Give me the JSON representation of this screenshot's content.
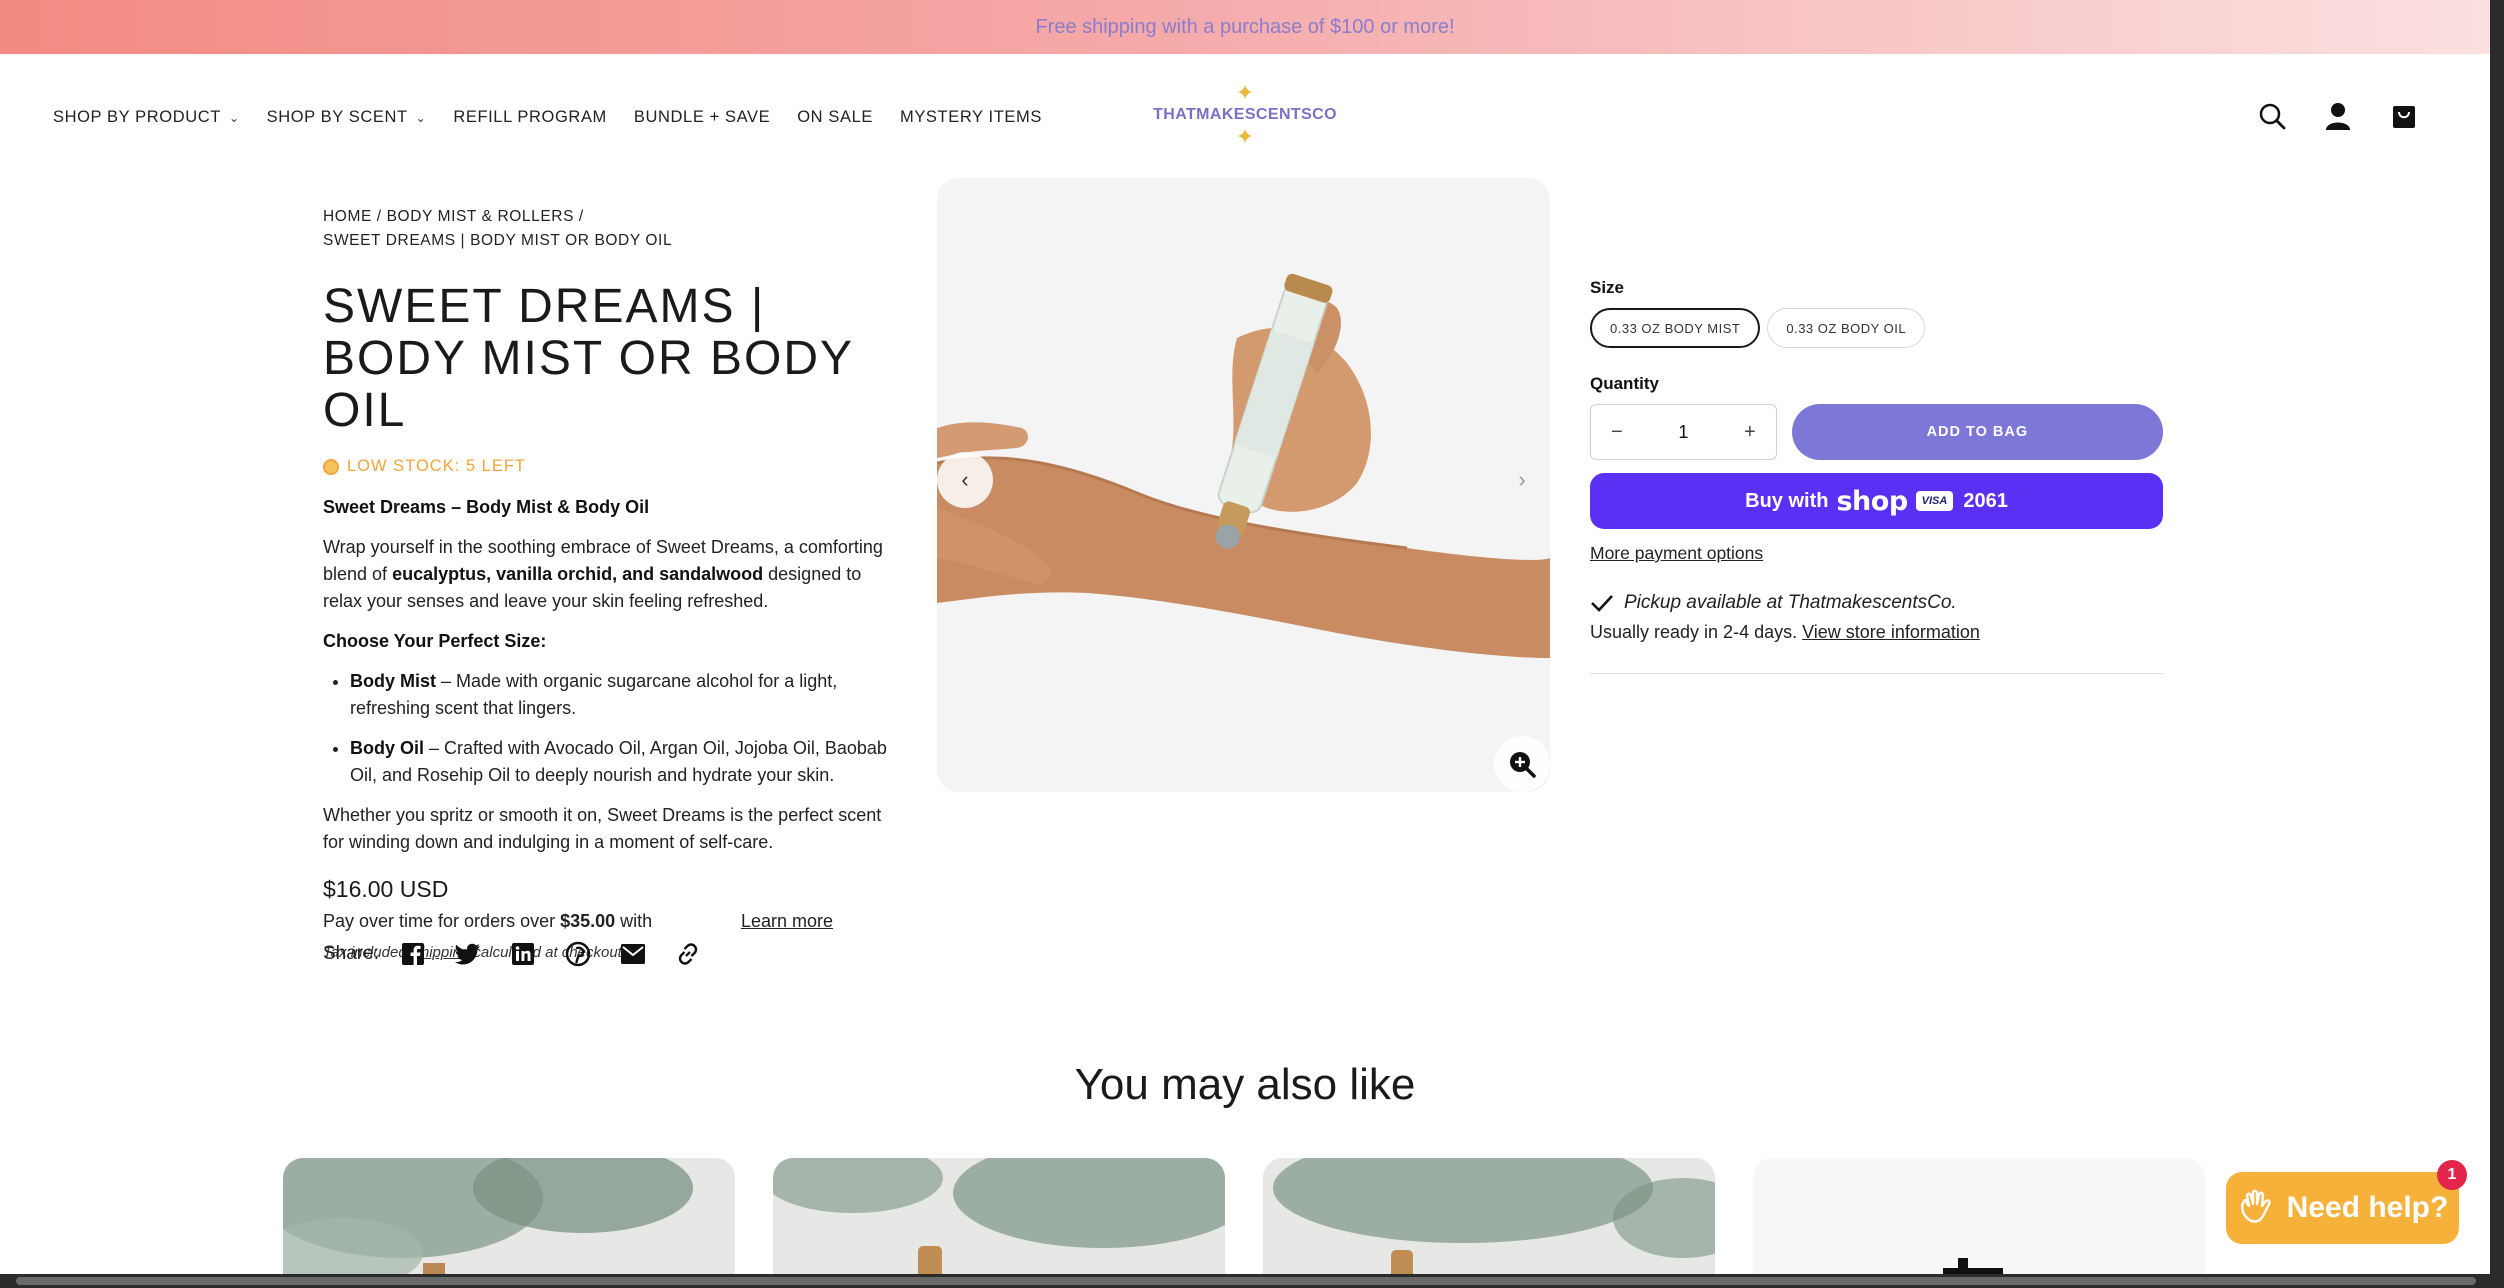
{
  "announcement": "Free shipping with a purchase of $100 or more!",
  "nav": [
    {
      "label": "SHOP BY PRODUCT",
      "dropdown": true
    },
    {
      "label": "SHOP BY SCENT",
      "dropdown": true
    },
    {
      "label": "REFILL PROGRAM",
      "dropdown": false
    },
    {
      "label": "BUNDLE + SAVE",
      "dropdown": false
    },
    {
      "label": "ON SALE",
      "dropdown": false
    },
    {
      "label": "MYSTERY ITEMS",
      "dropdown": false
    }
  ],
  "logo": {
    "text": "THATMAKESCENTSCO",
    "star_color": "#e6b93a",
    "text_color": "#7b70c6"
  },
  "header_icons": [
    "search-icon",
    "account-icon",
    "cart-icon"
  ],
  "breadcrumb": {
    "line1": "HOME / BODY MIST & ROLLERS /",
    "line2": "SWEET DREAMS | BODY MIST OR BODY OIL"
  },
  "product": {
    "title": "SWEET DREAMS | BODY MIST OR BODY OIL",
    "stock": "LOW STOCK: 5 LEFT",
    "desc_heading": "Sweet Dreams – Body Mist & Body Oil",
    "desc_p1_a": "Wrap yourself in the soothing embrace of Sweet Dreams, a comforting blend of ",
    "desc_p1_b": "eucalyptus, vanilla orchid, and sandalwood",
    "desc_p1_c": " designed to relax your senses and leave your skin feeling refreshed.",
    "choose_heading": "Choose Your Perfect Size:",
    "bullet1_b": "Body Mist",
    "bullet1_t": " – Made with organic sugarcane alcohol for a light, refreshing scent that lingers.",
    "bullet2_b": "Body Oil",
    "bullet2_t": " – Crafted with Avocado Oil, Argan Oil, Jojoba Oil, Baobab Oil, and Rosehip Oil to deeply nourish and hydrate your skin.",
    "desc_p2": "Whether you spritz or smooth it on, Sweet Dreams is the perfect scent for winding down and indulging in a moment of self-care.",
    "price": "$16.00 USD",
    "payover_a": "Pay over time for orders over ",
    "payover_b": "$35.00",
    "payover_c": " with",
    "learn_more": "Learn more",
    "tax_a": "Tax included.",
    "tax_link": "Shipping",
    "tax_b": " calculated at checkout.",
    "share_label": "Share:",
    "share_icons": [
      "facebook-icon",
      "twitter-icon",
      "linkedin-icon",
      "pinterest-icon",
      "email-icon",
      "link-icon"
    ]
  },
  "purchase": {
    "size_label": "Size",
    "sizes": [
      "0.33 OZ BODY MIST",
      "0.33 OZ BODY OIL"
    ],
    "selected_size": "0.33 OZ BODY MIST",
    "quantity_label": "Quantity",
    "quantity": "1",
    "minus": "−",
    "plus": "+",
    "add_to_bag": "ADD TO BAG",
    "shop_pay_a": "Buy with",
    "shop_pay_logo": "shop",
    "shop_pay_visa": "VISA",
    "shop_pay_num": "2061",
    "more_payment": "More payment options",
    "pickup": "Pickup available at ThatmakescentsCo.",
    "ready_a": "Usually ready in 2-4 days. ",
    "ready_link": "View store information"
  },
  "also_like": "You may also like",
  "help": {
    "label": "Need help?",
    "badge": "1"
  }
}
